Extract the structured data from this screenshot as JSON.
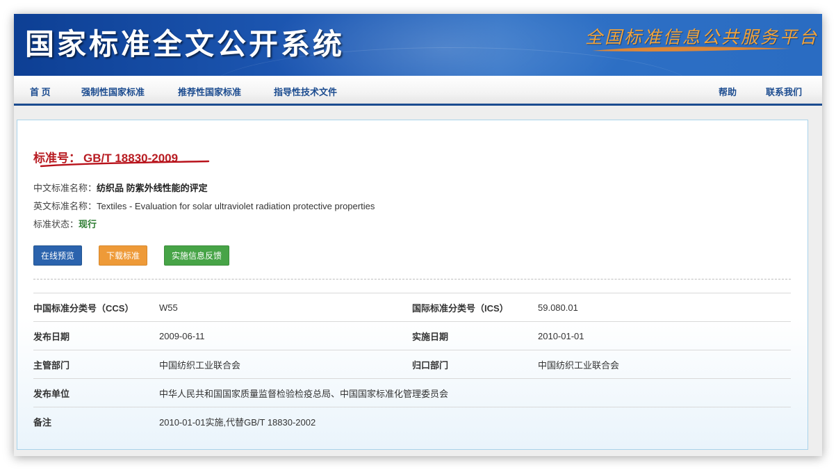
{
  "banner": {
    "title": "国家标准全文公开系统",
    "subtitle": "全国标准信息公共服务平台"
  },
  "nav": {
    "home": "首 页",
    "mandatory": "强制性国家标准",
    "recommended": "推荐性国家标准",
    "guidance": "指导性技术文件",
    "help": "帮助",
    "contact": "联系我们"
  },
  "standard": {
    "number_label": "标准号：",
    "number": "GB/T 18830-2009",
    "cn_name_label": "中文标准名称：",
    "cn_name": "纺织品 防紫外线性能的评定",
    "en_name_label": "英文标准名称：",
    "en_name": "Textiles - Evaluation for solar ultraviolet radiation protective properties",
    "status_label": "标准状态：",
    "status": "现行"
  },
  "buttons": {
    "preview": "在线预览",
    "download": "下载标准",
    "feedback": "实施信息反馈"
  },
  "meta": {
    "ccs_label": "中国标准分类号（CCS）",
    "ccs": "W55",
    "ics_label": "国际标准分类号（ICS）",
    "ics": "59.080.01",
    "publish_date_label": "发布日期",
    "publish_date": "2009-06-11",
    "impl_date_label": "实施日期",
    "impl_date": "2010-01-01",
    "dept_label": "主管部门",
    "dept": "中国纺织工业联合会",
    "owner_label": "归口部门",
    "owner": "中国纺织工业联合会",
    "publisher_label": "发布单位",
    "publisher": "中华人民共和国国家质量监督检验检疫总局、中国国家标准化管理委员会",
    "remark_label": "备注",
    "remark": "2010-01-01实施,代替GB/T 18830-2002"
  },
  "colors": {
    "banner_blue": "#1d57b2",
    "nav_text": "#1b4b8f",
    "std_red": "#b81c22",
    "status_green": "#2e7d32",
    "btn_blue": "#2b63ad",
    "btn_orange": "#ee9a38",
    "btn_green": "#47a447"
  }
}
